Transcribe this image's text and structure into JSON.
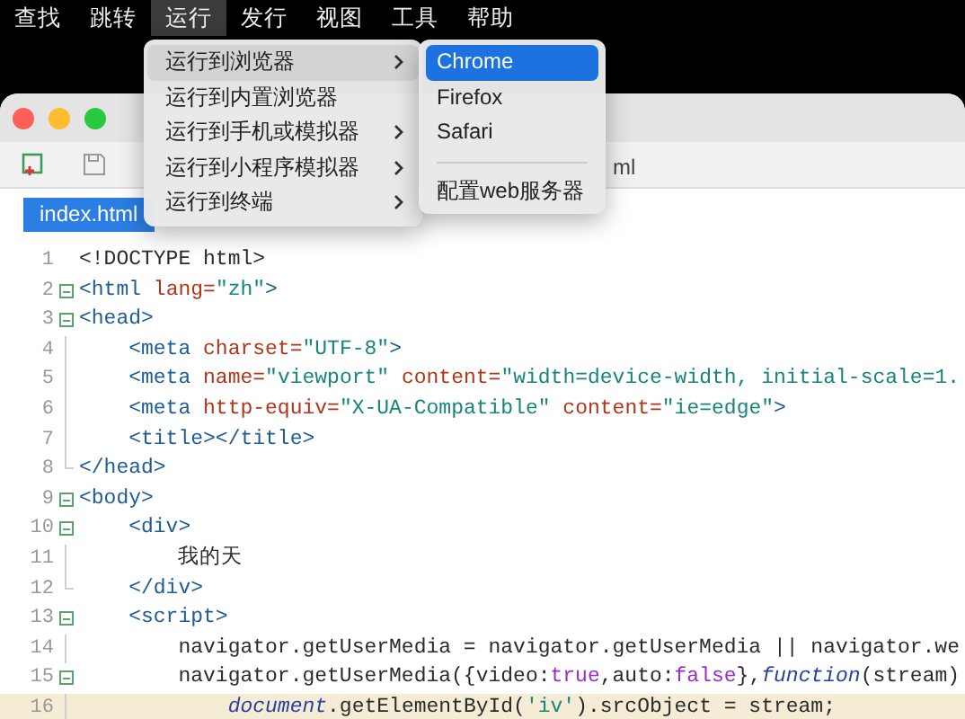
{
  "menu_bar": [
    {
      "label": "查找",
      "selected": false
    },
    {
      "label": "跳转",
      "selected": false
    },
    {
      "label": "运行",
      "selected": true
    },
    {
      "label": "发行",
      "selected": false
    },
    {
      "label": "视图",
      "selected": false
    },
    {
      "label": "工具",
      "selected": false
    },
    {
      "label": "帮助",
      "selected": false
    }
  ],
  "run_menu": {
    "items": [
      {
        "label": "运行到浏览器",
        "submenu": true,
        "selected": true
      },
      {
        "label": "运行到内置浏览器",
        "submenu": false,
        "selected": false
      },
      {
        "label": "运行到手机或模拟器",
        "submenu": true,
        "selected": false
      },
      {
        "label": "运行到小程序模拟器",
        "submenu": true,
        "selected": false
      },
      {
        "label": "运行到终端",
        "submenu": true,
        "selected": false
      }
    ]
  },
  "browser_submenu": {
    "items": [
      {
        "kind": "item",
        "label": "Chrome",
        "selected": true
      },
      {
        "kind": "item",
        "label": "Firefox",
        "selected": false
      },
      {
        "kind": "item",
        "label": "Safari",
        "selected": false
      },
      {
        "kind": "separator"
      },
      {
        "kind": "item",
        "label": "配置web服务器",
        "selected": false
      }
    ]
  },
  "window": {
    "title": "ml"
  },
  "tabs": [
    {
      "label": "index.html",
      "selected": true
    }
  ],
  "editor": {
    "lines": [
      {
        "number": "1",
        "kind": "plain",
        "current": false,
        "tokens": [
          {
            "text": "<!DOCTYPE html>",
            "kind": "plain"
          }
        ]
      },
      {
        "number": "2",
        "kind": "fold",
        "current": false,
        "tokens": [
          {
            "text": "<html",
            "kind": "tag"
          },
          {
            "text": " lang=",
            "kind": "attr"
          },
          {
            "text": "\"zh\"",
            "kind": "string"
          },
          {
            "text": ">",
            "kind": "tag"
          }
        ]
      },
      {
        "number": "3",
        "kind": "fold",
        "current": false,
        "tokens": [
          {
            "text": "<head>",
            "kind": "tag"
          }
        ]
      },
      {
        "number": "4",
        "kind": "guide",
        "current": false,
        "tokens": [
          {
            "text": "    <meta",
            "kind": "tag"
          },
          {
            "text": " charset=",
            "kind": "attr"
          },
          {
            "text": "\"UTF-8\"",
            "kind": "string"
          },
          {
            "text": ">",
            "kind": "tag"
          }
        ]
      },
      {
        "number": "5",
        "kind": "guide",
        "current": false,
        "tokens": [
          {
            "text": "    <meta",
            "kind": "tag"
          },
          {
            "text": " name=",
            "kind": "attr"
          },
          {
            "text": "\"viewport\"",
            "kind": "string"
          },
          {
            "text": " content=",
            "kind": "attr"
          },
          {
            "text": "\"width=device-width, initial-scale=1.",
            "kind": "string"
          }
        ]
      },
      {
        "number": "6",
        "kind": "guide",
        "current": false,
        "tokens": [
          {
            "text": "    <meta",
            "kind": "tag"
          },
          {
            "text": " http-equiv=",
            "kind": "attr"
          },
          {
            "text": "\"X-UA-Compatible\"",
            "kind": "string"
          },
          {
            "text": " content=",
            "kind": "attr"
          },
          {
            "text": "\"ie=edge\"",
            "kind": "string"
          },
          {
            "text": ">",
            "kind": "tag"
          }
        ]
      },
      {
        "number": "7",
        "kind": "guide",
        "current": false,
        "tokens": [
          {
            "text": "    <title></title>",
            "kind": "tag"
          }
        ]
      },
      {
        "number": "8",
        "kind": "end",
        "current": false,
        "tokens": [
          {
            "text": "</head>",
            "kind": "tag"
          }
        ]
      },
      {
        "number": "9",
        "kind": "fold",
        "current": false,
        "tokens": [
          {
            "text": "<body>",
            "kind": "tag"
          }
        ]
      },
      {
        "number": "10",
        "kind": "fold",
        "current": false,
        "tokens": [
          {
            "text": "    <div>",
            "kind": "tag"
          }
        ]
      },
      {
        "number": "11",
        "kind": "guide",
        "current": false,
        "tokens": [
          {
            "text": "        我的天",
            "kind": "plain"
          }
        ]
      },
      {
        "number": "12",
        "kind": "end",
        "current": false,
        "tokens": [
          {
            "text": "    </div>",
            "kind": "tag"
          }
        ]
      },
      {
        "number": "13",
        "kind": "fold",
        "current": false,
        "tokens": [
          {
            "text": "    <script>",
            "kind": "tag"
          }
        ]
      },
      {
        "number": "14",
        "kind": "guide",
        "current": false,
        "tokens": [
          {
            "text": "        navigator.getUserMedia = navigator.getUserMedia || navigator.we",
            "kind": "plain"
          }
        ]
      },
      {
        "number": "15",
        "kind": "fold",
        "current": false,
        "tokens": [
          {
            "text": "        navigator.getUserMedia({video:",
            "kind": "plain"
          },
          {
            "text": "true",
            "kind": "keyword"
          },
          {
            "text": ",auto:",
            "kind": "plain"
          },
          {
            "text": "false",
            "kind": "keyword"
          },
          {
            "text": "},",
            "kind": "plain"
          },
          {
            "text": "function",
            "kind": "italic"
          },
          {
            "text": "(stream)",
            "kind": "plain"
          }
        ]
      },
      {
        "number": "16",
        "kind": "guide",
        "current": true,
        "tokens": [
          {
            "text": "            document",
            "kind": "italic"
          },
          {
            "text": ".getElementById(",
            "kind": "plain"
          },
          {
            "text": "'iv'",
            "kind": "string"
          },
          {
            "text": ").srcObject = stream;",
            "kind": "plain"
          }
        ]
      }
    ]
  }
}
